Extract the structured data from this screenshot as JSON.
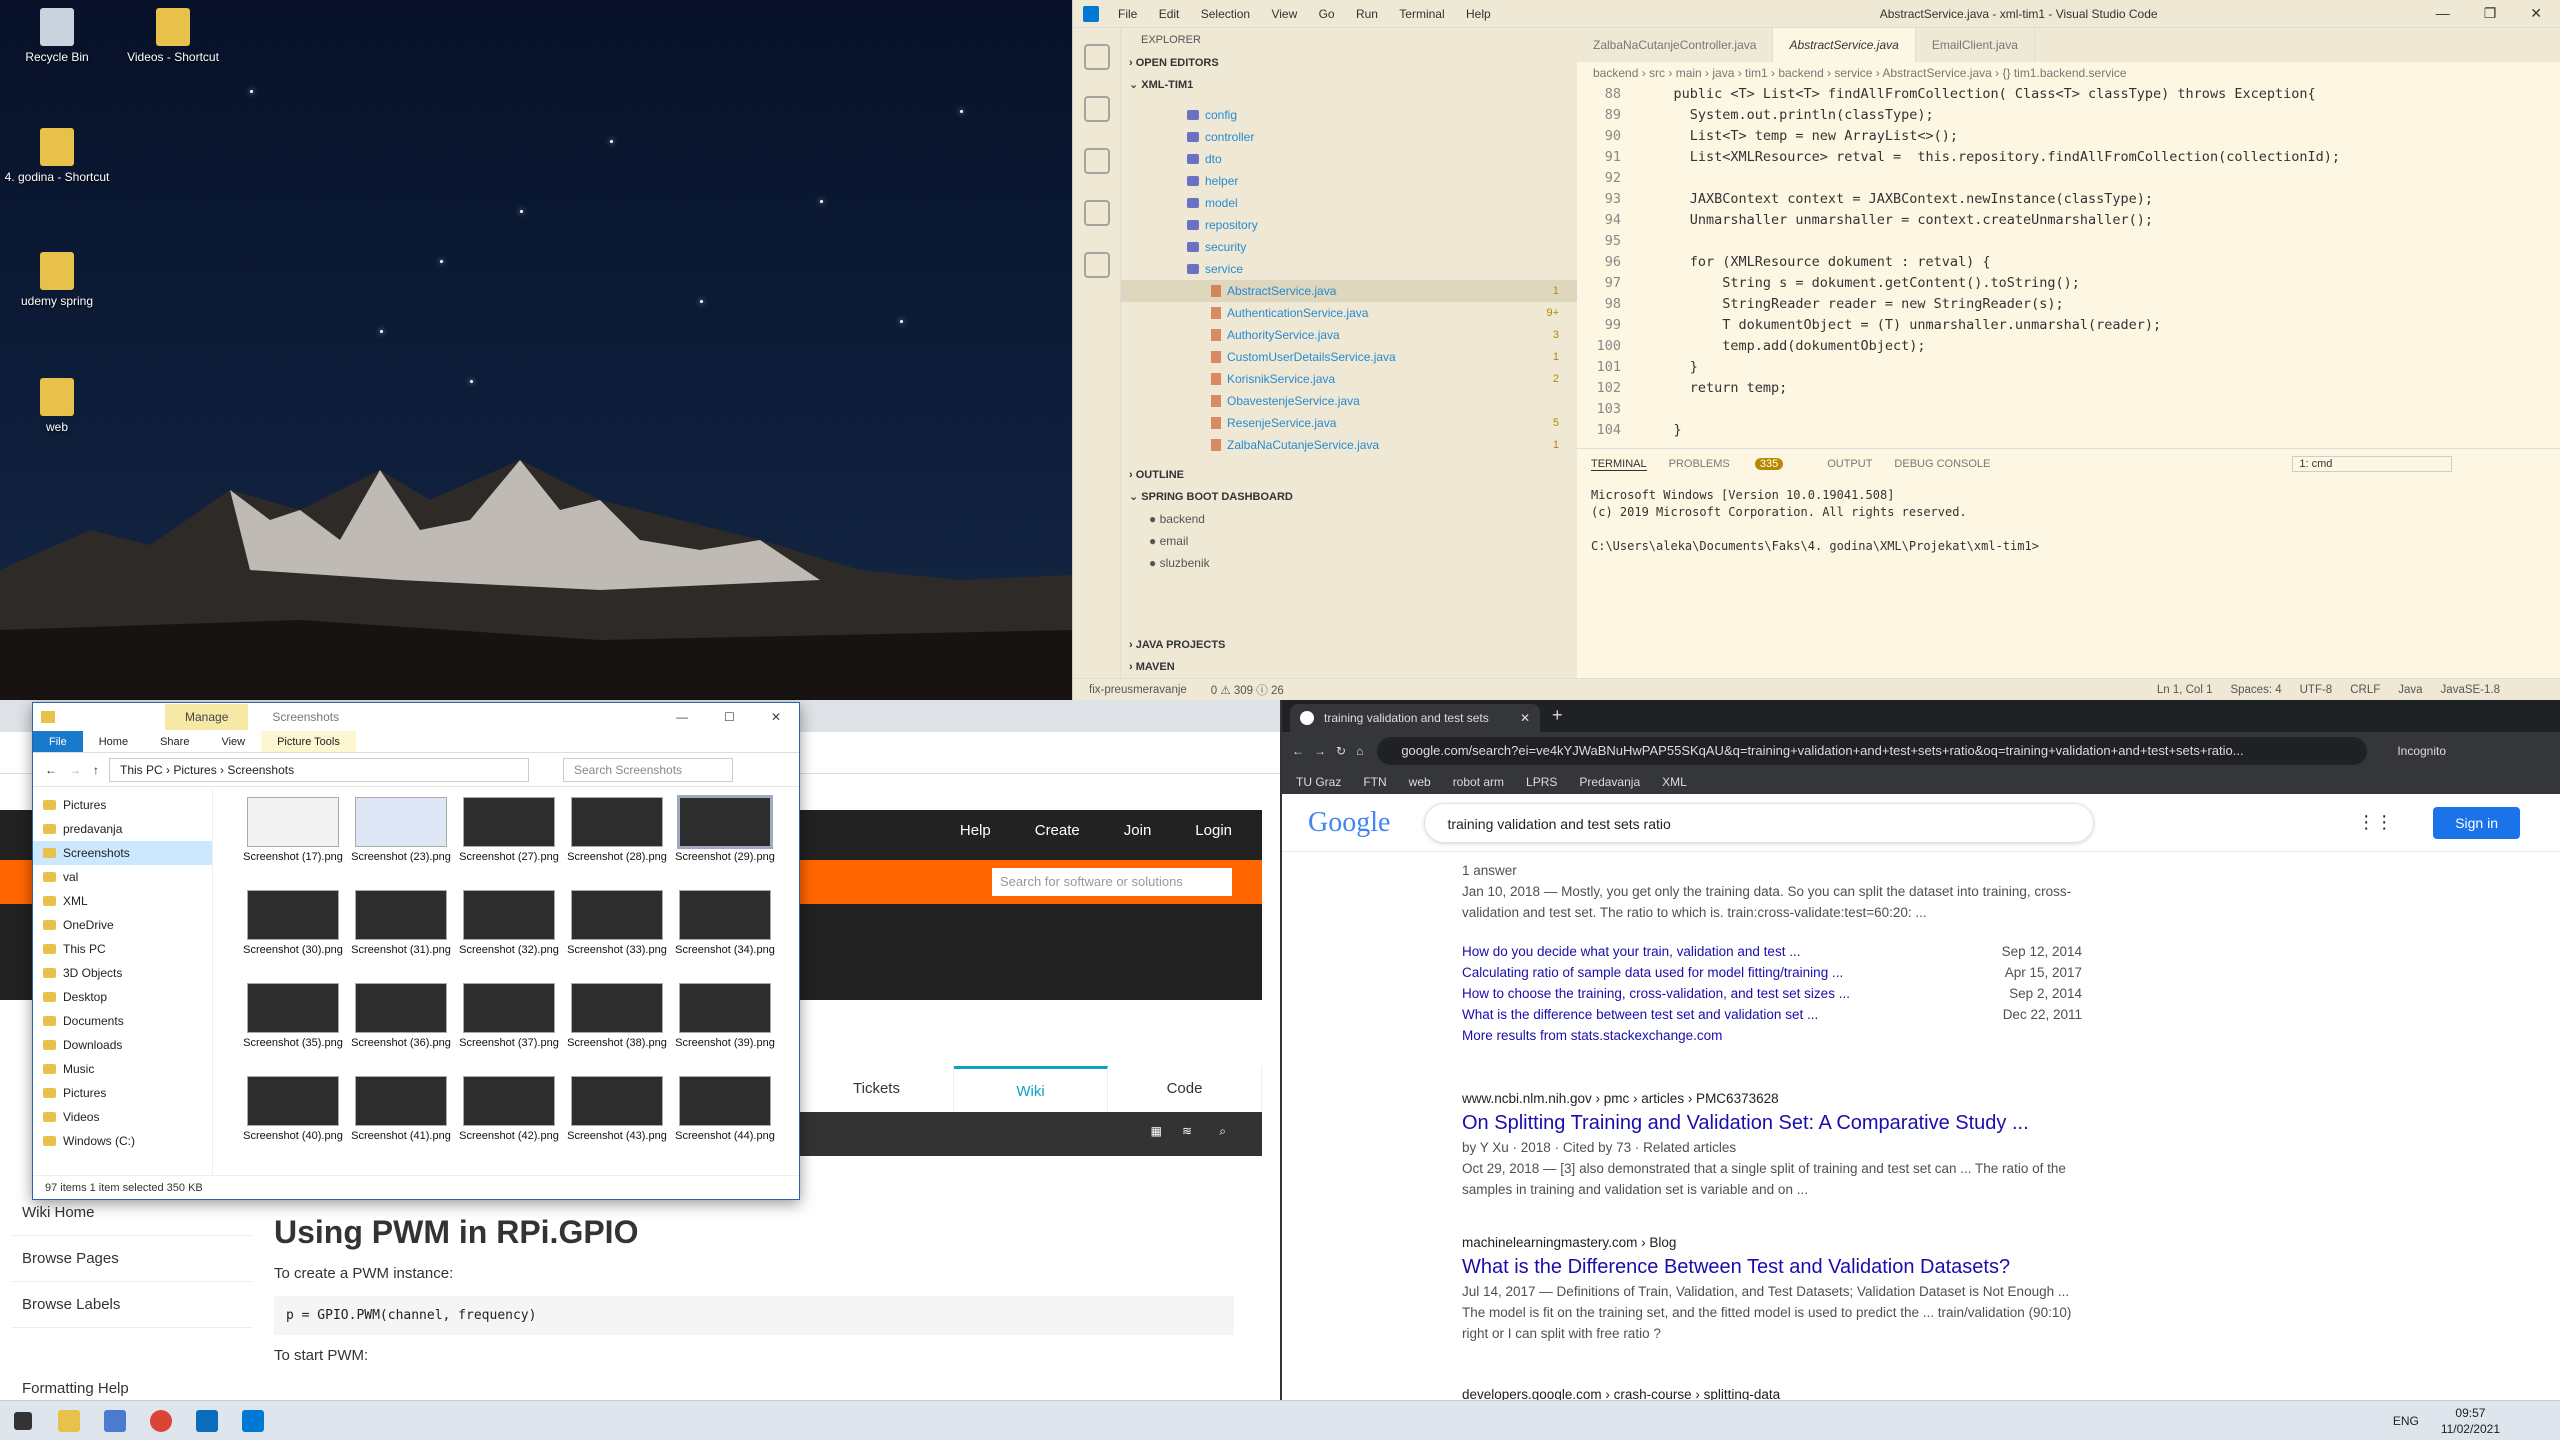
{
  "desktop": {
    "icons": [
      "Recycle Bin",
      "Videos - Shortcut",
      "4. godina - Shortcut",
      "udemy spring",
      "web"
    ]
  },
  "vscode": {
    "menu": [
      "File",
      "Edit",
      "Selection",
      "View",
      "Go",
      "Run",
      "Terminal",
      "Help"
    ],
    "title": "AbstractService.java - xml-tim1 - Visual Studio Code",
    "explorer_label": "EXPLORER",
    "open_editors": "OPEN EDITORS",
    "project": "XML-TIM1",
    "folders": [
      "config",
      "controller",
      "dto",
      "helper",
      "model",
      "repository",
      "security",
      "service"
    ],
    "files": [
      {
        "name": "AbstractService.java",
        "badge": "1"
      },
      {
        "name": "AuthenticationService.java",
        "badge": "9+"
      },
      {
        "name": "AuthorityService.java",
        "badge": "3"
      },
      {
        "name": "CustomUserDetailsService.java",
        "badge": "1"
      },
      {
        "name": "KorisnikService.java",
        "badge": "2"
      },
      {
        "name": "ObavestenjeService.java",
        "badge": ""
      },
      {
        "name": "ResenjeService.java",
        "badge": "5"
      },
      {
        "name": "ZalbaNaCutanjeService.java",
        "badge": "1"
      }
    ],
    "outline": "OUTLINE",
    "spring_boot": "SPRING BOOT DASHBOARD",
    "spring_apps": [
      "backend",
      "email",
      "sluzbenik"
    ],
    "java_projects": "JAVA PROJECTS",
    "maven": "MAVEN",
    "tabs": [
      "ZalbaNaCutanjeController.java",
      "AbstractService.java",
      "EmailClient.java"
    ],
    "breadcrumb": "backend › src › main › java › tim1 › backend › service › AbstractService.java › {} tim1.backend.service",
    "code": [
      {
        "n": "88",
        "t": "    public <T> List<T> findAllFromCollection( Class<T> classType) throws Exception{"
      },
      {
        "n": "89",
        "t": "      System.out.println(classType);"
      },
      {
        "n": "90",
        "t": "      List<T> temp = new ArrayList<>();"
      },
      {
        "n": "91",
        "t": "      List<XMLResource> retval =  this.repository.findAllFromCollection(collectionId);"
      },
      {
        "n": "92",
        "t": ""
      },
      {
        "n": "93",
        "t": "      JAXBContext context = JAXBContext.newInstance(classType);"
      },
      {
        "n": "94",
        "t": "      Unmarshaller unmarshaller = context.createUnmarshaller();"
      },
      {
        "n": "95",
        "t": ""
      },
      {
        "n": "96",
        "t": "      for (XMLResource dokument : retval) {"
      },
      {
        "n": "97",
        "t": "          String s = dokument.getContent().toString();"
      },
      {
        "n": "98",
        "t": "          StringReader reader = new StringReader(s);"
      },
      {
        "n": "99",
        "t": "          T dokumentObject = (T) unmarshaller.unmarshal(reader);"
      },
      {
        "n": "100",
        "t": "          temp.add(dokumentObject);"
      },
      {
        "n": "101",
        "t": "      }"
      },
      {
        "n": "102",
        "t": "      return temp;"
      },
      {
        "n": "103",
        "t": ""
      },
      {
        "n": "104",
        "t": "    }"
      }
    ],
    "panel_tabs": [
      "TERMINAL",
      "PROBLEMS",
      "OUTPUT",
      "DEBUG CONSOLE"
    ],
    "problems_count": "335",
    "terminal_select": "1: cmd",
    "terminal": "Microsoft Windows [Version 10.0.19041.508]\n(c) 2019 Microsoft Corporation. All rights reserved.\n\nC:\\Users\\aleka\\Documents\\Faks\\4. godina\\XML\\Projekat\\xml-tim1>",
    "status_left": "fix-preusmeravanje",
    "status_errors": "0 ⚠ 309 ⓘ 26",
    "status_right": [
      "Ln 1, Col 1",
      "Spaces: 4",
      "UTF-8",
      "CRLF",
      "Java",
      "JavaSE-1.8"
    ]
  },
  "explorer": {
    "manage": "Manage",
    "title": "Screenshots",
    "ribbon": [
      "File",
      "Home",
      "Share",
      "View",
      "Picture Tools"
    ],
    "path": [
      "This PC",
      "Pictures",
      "Screenshots"
    ],
    "search_placeholder": "Search Screenshots",
    "nav": [
      "Pictures",
      "predavanja",
      "Screenshots",
      "val",
      "XML",
      "OneDrive",
      "This PC",
      "3D Objects",
      "Desktop",
      "Documents",
      "Downloads",
      "Music",
      "Pictures",
      "Videos",
      "Windows (C:)"
    ],
    "thumbs": [
      "Screenshot (17).png",
      "Screenshot (23).png",
      "Screenshot (27).png",
      "Screenshot (28).png",
      "Screenshot (29).png",
      "Screenshot (30).png",
      "Screenshot (31).png",
      "Screenshot (32).png",
      "Screenshot (33).png",
      "Screenshot (34).png",
      "Screenshot (35).png",
      "Screenshot (36).png",
      "Screenshot (37).png",
      "Screenshot (38).png",
      "Screenshot (39).png",
      "Screenshot (40).png",
      "Screenshot (41).png",
      "Screenshot (42).png",
      "Screenshot (43).png",
      "Screenshot (44).png"
    ],
    "status": "97 items     1 item selected  350 KB"
  },
  "left_browser": {
    "nav_links": [
      "Help",
      "Create",
      "Join",
      "Login"
    ],
    "search_placeholder": "Search for software or solutions",
    "wiki_tabs": [
      "Tickets",
      "Wiki",
      "Code"
    ],
    "sidebar": [
      "Wiki Home",
      "Browse Pages",
      "Browse Labels",
      "Formatting Help"
    ],
    "heading": "Using PWM in RPi.GPIO",
    "p1": "To create a PWM instance:",
    "code": "p = GPIO.PWM(channel, frequency)",
    "p2": "To start PWM:"
  },
  "right_browser": {
    "tab_title": "training validation and test sets",
    "url": "google.com/search?ei=ve4kYJWaBNuHwPAP55SKqAU&q=training+validation+and+test+sets+ratio&oq=training+validation+and+test+sets+ratio...",
    "incognito": "Incognito",
    "bookmarks": [
      "TU Graz",
      "FTN",
      "web",
      "robot arm",
      "LPRS",
      "Predavanja",
      "XML"
    ],
    "google": "Google",
    "query": "training validation and test sets ratio",
    "signin": "Sign in",
    "r0_meta": "1 answer",
    "r0_snip": "Jan 10, 2018 — Mostly, you get only the training data. So you can split the dataset into training, cross-validation and test set. The ratio to which is. train:cross-validate:test=60:20: ...",
    "related": [
      {
        "t": "How do you decide what your train, validation and test ...",
        "d": "Sep 12, 2014"
      },
      {
        "t": "Calculating ratio of sample data used for model fitting/training ...",
        "d": "Apr 15, 2017"
      },
      {
        "t": "How to choose the training, cross-validation, and test set sizes ...",
        "d": "Sep 2, 2014"
      },
      {
        "t": "What is the difference between test set and validation set ...",
        "d": "Dec 22, 2011"
      }
    ],
    "more": "More results from stats.stackexchange.com",
    "r1_url": "www.ncbi.nlm.nih.gov › pmc › articles › PMC6373628",
    "r1_title": "On Splitting Training and Validation Set: A Comparative Study ...",
    "r1_meta": "by Y Xu · 2018 · Cited by 73 · Related articles",
    "r1_snip": "Oct 29, 2018 — [3] also demonstrated that a single split of training and test set can ... The ratio of the samples in training and validation set is variable and on ...",
    "r2_url": "machinelearningmastery.com › Blog",
    "r2_title": "What is the Difference Between Test and Validation Datasets?",
    "r2_snip": "Jul 14, 2017 — Definitions of Train, Validation, and Test Datasets; Validation Dataset is Not Enough ... The model is fit on the training set, and the fitted model is used to predict the ... train/validation (90:10) right or I can split with free ratio ?",
    "r3_url": "developers.google.com › crash-course › splitting-data"
  },
  "taskbar": {
    "lang": "ENG",
    "time": "09:57",
    "date": "11/02/2021"
  }
}
